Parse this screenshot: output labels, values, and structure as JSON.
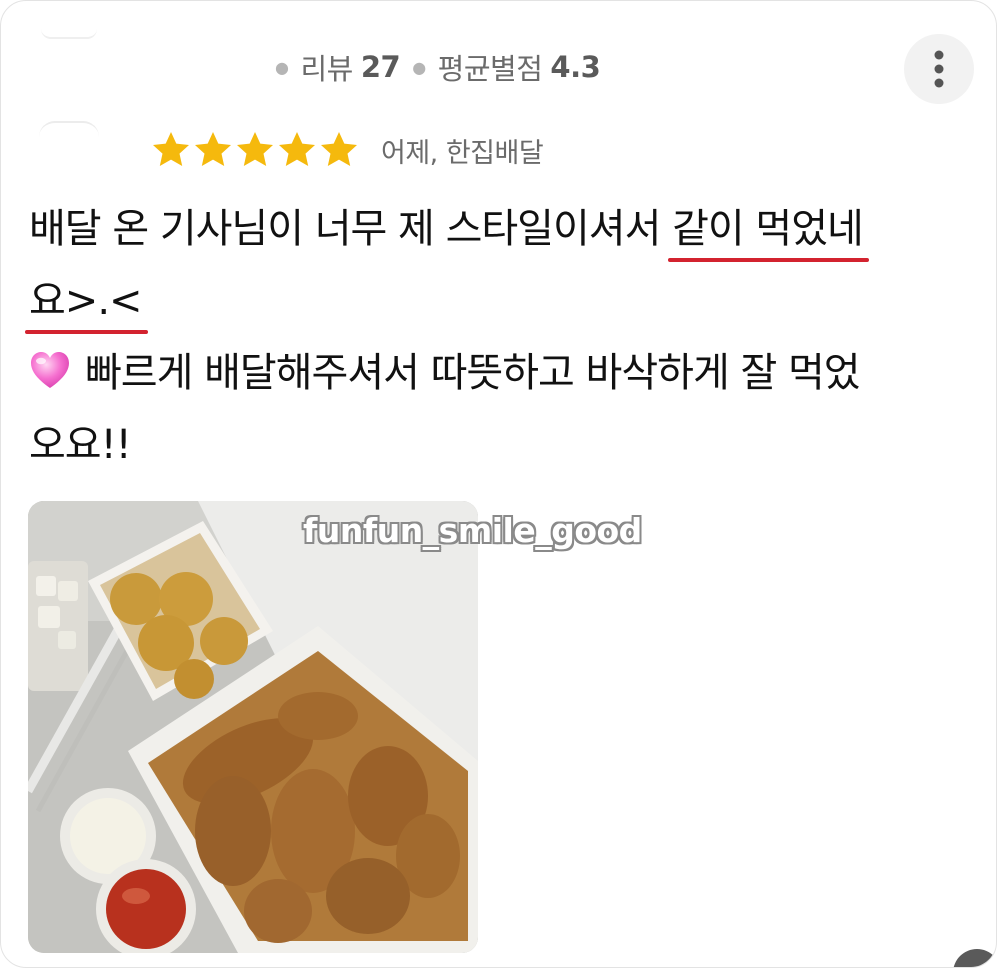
{
  "header": {
    "reviews_label": "리뷰",
    "reviews_count": "27",
    "average_label": "평균별점",
    "average_value": "4.3"
  },
  "review": {
    "rating": 5,
    "rating_max": 5,
    "star_color": "#f5b90d",
    "meta": "어제, 한집배달",
    "lines": {
      "line1_a": "배달 온 기사님이 너무 제 스타일이셔서 ",
      "line1_b": "같이 먹었네",
      "line2": "요>.<",
      "line3": "빠르게 배달해주셔서 따뜻하고 바삭하게 잘 먹었",
      "line4": "오요!!"
    },
    "highlight_color": "#d3232f",
    "emoji": "pink-heart-icon"
  },
  "photo": {
    "description_icon": "fried-chicken-photo"
  },
  "watermark": "funfun_smile_good"
}
